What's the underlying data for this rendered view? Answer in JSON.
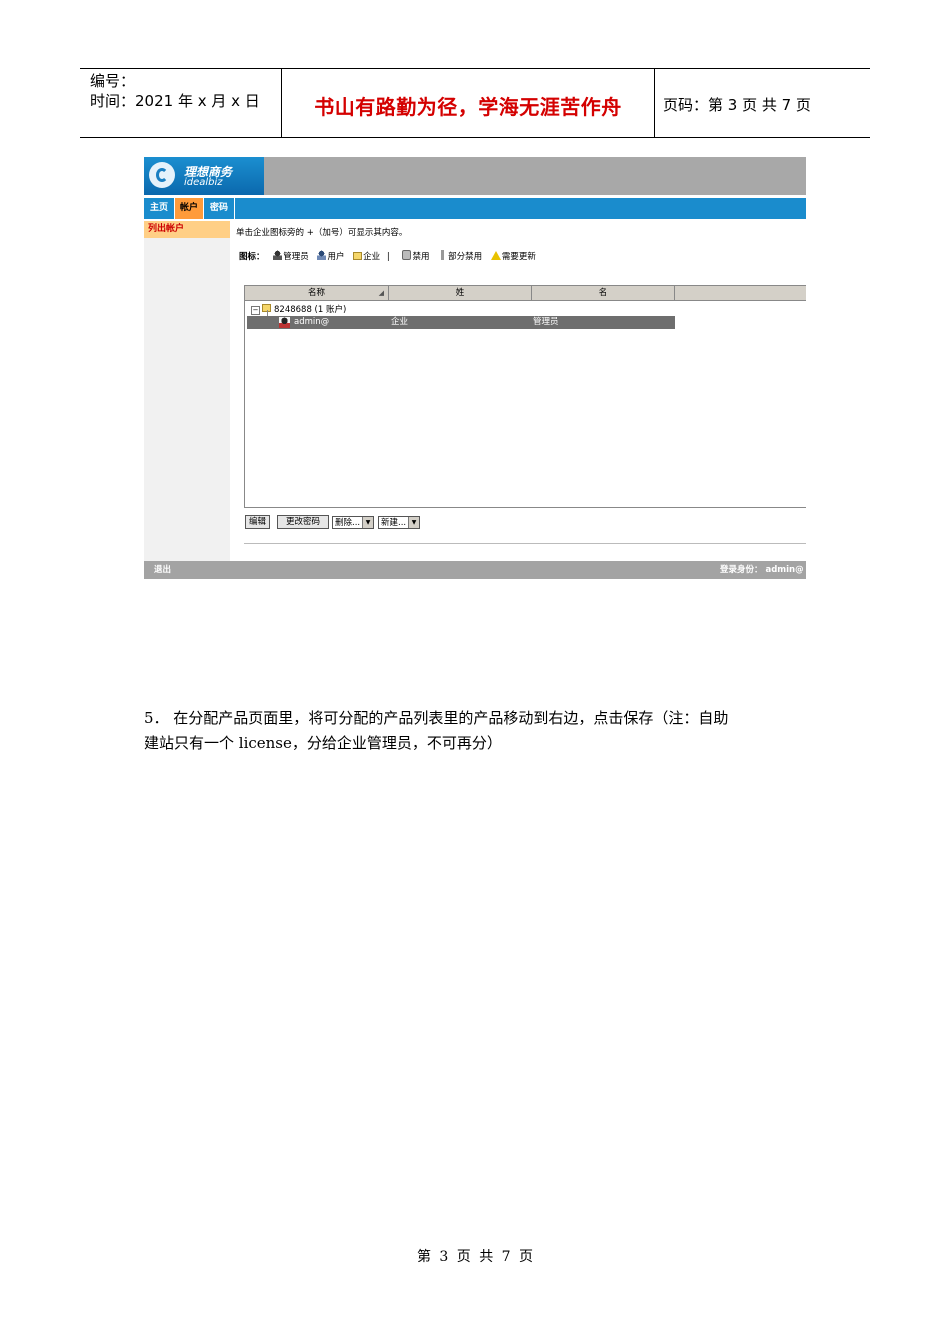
{
  "header": {
    "number_label": "编号：",
    "date_label": "时间：2021 年 x 月 x 日",
    "motto": "书山有路勤为径，学海无涯苦作舟",
    "page_label": "页码：第 3 页  共 7 页"
  },
  "app": {
    "logo_cn": "理想商务",
    "logo_en": "idealbiz",
    "tabs": [
      "主页",
      "帐户",
      "密码"
    ],
    "sidebar_item": "列出帐户",
    "hint": "单击企业图标旁的 +（加号）可显示其内容。",
    "legend": {
      "title": "图标：",
      "items": [
        "管理员",
        "用户",
        "企业",
        "禁用",
        "部分禁用",
        "需要更新"
      ]
    },
    "table": {
      "headers": [
        "名称",
        "姓",
        "名",
        ""
      ],
      "tree_node": "8248688 (1 账户)",
      "row": [
        "admin@",
        "企业",
        "管理员"
      ]
    },
    "buttons": {
      "edit": "编辑",
      "change_password": "更改密码",
      "delete_select": "删除...",
      "new_select": "新建..."
    },
    "footer": {
      "logout": "退出",
      "login_identity": "登录身份：  admin@"
    }
  },
  "body": {
    "line1": "5．  在分配产品页面里，将可分配的产品列表里的产品移动到右边，点击保存（注：自助",
    "line2": "建站只有一个 license，分给企业管理员，不可再分）"
  },
  "page_footer": "第 3 页 共 7 页"
}
